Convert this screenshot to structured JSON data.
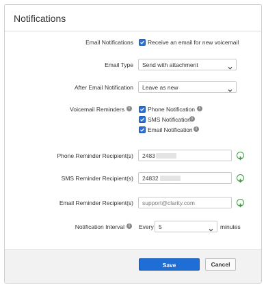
{
  "title": "Notifications",
  "email_notifications": {
    "label": "Email Notifications",
    "checkbox_label": "Receive an email for new voicemail",
    "checked": true
  },
  "email_type": {
    "label": "Email Type",
    "value": "Send with attachment"
  },
  "after_email": {
    "label": "After Email Notification",
    "value": "Leave as new"
  },
  "voicemail_reminders": {
    "label": "Voicemail Reminders",
    "options": [
      {
        "label": "Phone Notification",
        "checked": true
      },
      {
        "label": "SMS Notification",
        "checked": true
      },
      {
        "label": "Email Notification",
        "checked": true
      }
    ]
  },
  "phone_recipients": {
    "label": "Phone Reminder Recipient(s)",
    "value": "2483"
  },
  "sms_recipients": {
    "label": "SMS Reminder Recipient(s)",
    "value": "24832"
  },
  "email_recipients": {
    "label": "Email Reminder Recipient(s)",
    "placeholder": "support@clarity.com"
  },
  "interval": {
    "label": "Notification Interval",
    "prefix": "Every",
    "value": "5",
    "suffix": "minutes"
  },
  "buttons": {
    "save": "Save",
    "cancel": "Cancel"
  },
  "colors": {
    "primary": "#1e6ed6",
    "add": "#3c9a3c"
  }
}
